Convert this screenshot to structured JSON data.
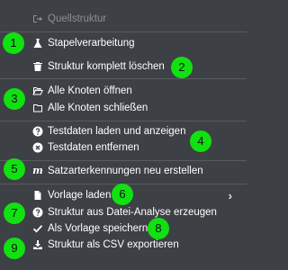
{
  "menu": {
    "items": [
      {
        "label": "Quellstruktur",
        "icon": "sign-out-icon",
        "disabled": true
      },
      {
        "label": "Stapelverarbeitung",
        "icon": "flask-icon"
      },
      {
        "label": "Struktur komplett löschen",
        "icon": "trash-icon"
      },
      {
        "label": "Alle Knoten öffnen",
        "icon": "folder-open-icon"
      },
      {
        "label": "Alle Knoten schließen",
        "icon": "folder-icon"
      },
      {
        "label": "Testdaten laden und anzeigen",
        "icon": "question-circle-icon"
      },
      {
        "label": "Testdaten entfernen",
        "icon": "times-circle-icon"
      },
      {
        "label": "Satzarterkennungen neu erstellen",
        "icon": "m-icon"
      },
      {
        "label": "Vorlage laden",
        "icon": "file-icon",
        "has_submenu": true
      },
      {
        "label": "Struktur aus Datei-Analyse erzeugen",
        "icon": "question-circle-icon"
      },
      {
        "label": "Als Vorlage speichern",
        "icon": "check-icon"
      },
      {
        "label": "Struktur als CSV exportieren",
        "icon": "download-icon"
      }
    ],
    "submenu_glyph": "›",
    "m_glyph": "m"
  },
  "annotations": [
    "1",
    "2",
    "3",
    "4",
    "5",
    "6",
    "7",
    "8",
    "9"
  ],
  "colors": {
    "background": "#3d4044",
    "text": "#ffffff",
    "disabled_text": "#8c8f93",
    "separator": "#585c61",
    "badge": "#11e011"
  }
}
